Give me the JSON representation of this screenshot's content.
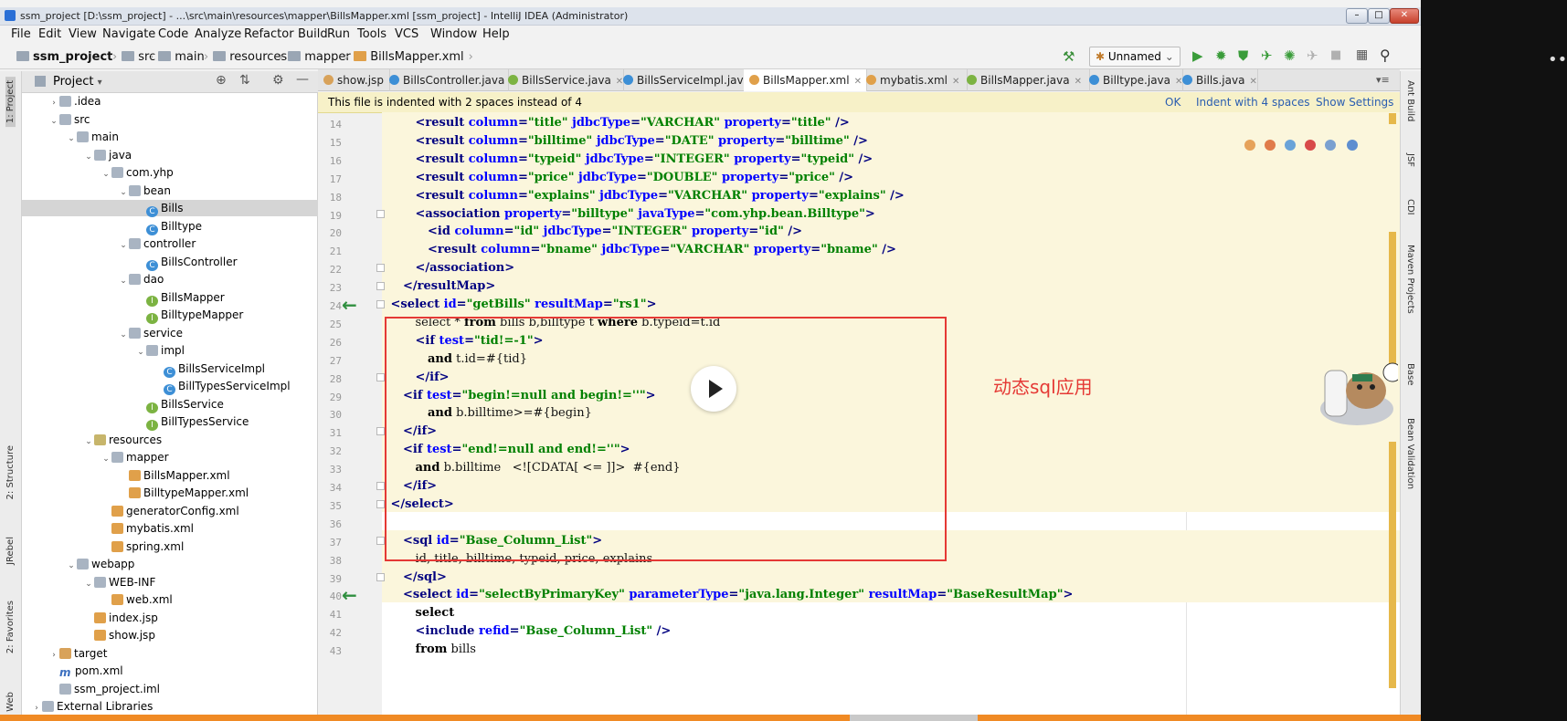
{
  "window": {
    "title": "ssm_project [D:\\ssm_project] - ...\\src\\main\\resources\\mapper\\BillsMapper.xml [ssm_project] - IntelliJ IDEA (Administrator)"
  },
  "menu": [
    "File",
    "Edit",
    "View",
    "Navigate",
    "Code",
    "Analyze",
    "Refactor",
    "Build",
    "Run",
    "Tools",
    "VCS",
    "Window",
    "Help"
  ],
  "breadcrumb": [
    "ssm_project",
    "src",
    "main",
    "resources",
    "mapper",
    "BillsMapper.xml"
  ],
  "run_config": "Unnamed",
  "project_panel": {
    "title": "Project",
    "tree": [
      {
        "label": ".idea",
        "indent": 1,
        "arrow": "›",
        "icon": "folder"
      },
      {
        "label": "src",
        "indent": 1,
        "arrow": "⌄",
        "icon": "folder"
      },
      {
        "label": "main",
        "indent": 2,
        "arrow": "⌄",
        "icon": "folder"
      },
      {
        "label": "java",
        "indent": 3,
        "arrow": "⌄",
        "icon": "folder"
      },
      {
        "label": "com.yhp",
        "indent": 4,
        "arrow": "⌄",
        "icon": "folder"
      },
      {
        "label": "bean",
        "indent": 5,
        "arrow": "⌄",
        "icon": "folder"
      },
      {
        "label": "Bills",
        "indent": 6,
        "arrow": "",
        "icon": "class"
      },
      {
        "label": "Billtype",
        "indent": 6,
        "arrow": "",
        "icon": "class"
      },
      {
        "label": "controller",
        "indent": 5,
        "arrow": "⌄",
        "icon": "folder"
      },
      {
        "label": "BillsController",
        "indent": 6,
        "arrow": "",
        "icon": "class"
      },
      {
        "label": "dao",
        "indent": 5,
        "arrow": "⌄",
        "icon": "folder"
      },
      {
        "label": "BillsMapper",
        "indent": 6,
        "arrow": "",
        "icon": "iface"
      },
      {
        "label": "BilltypeMapper",
        "indent": 6,
        "arrow": "",
        "icon": "iface"
      },
      {
        "label": "service",
        "indent": 5,
        "arrow": "⌄",
        "icon": "folder"
      },
      {
        "label": "impl",
        "indent": 6,
        "arrow": "⌄",
        "icon": "folder"
      },
      {
        "label": "BillsServiceImpl",
        "indent": 7,
        "arrow": "",
        "icon": "class"
      },
      {
        "label": "BillTypesServiceImpl",
        "indent": 7,
        "arrow": "",
        "icon": "class"
      },
      {
        "label": "BillsService",
        "indent": 6,
        "arrow": "",
        "icon": "iface"
      },
      {
        "label": "BillTypesService",
        "indent": 6,
        "arrow": "",
        "icon": "iface"
      },
      {
        "label": "resources",
        "indent": 3,
        "arrow": "⌄",
        "icon": "res"
      },
      {
        "label": "mapper",
        "indent": 4,
        "arrow": "⌄",
        "icon": "folder"
      },
      {
        "label": "BillsMapper.xml",
        "indent": 5,
        "arrow": "",
        "icon": "xml"
      },
      {
        "label": "BilltypeMapper.xml",
        "indent": 5,
        "arrow": "",
        "icon": "xml"
      },
      {
        "label": "generatorConfig.xml",
        "indent": 4,
        "arrow": "",
        "icon": "xml"
      },
      {
        "label": "mybatis.xml",
        "indent": 4,
        "arrow": "",
        "icon": "xml"
      },
      {
        "label": "spring.xml",
        "indent": 4,
        "arrow": "",
        "icon": "xml"
      },
      {
        "label": "webapp",
        "indent": 2,
        "arrow": "⌄",
        "icon": "folder"
      },
      {
        "label": "WEB-INF",
        "indent": 3,
        "arrow": "⌄",
        "icon": "folder"
      },
      {
        "label": "web.xml",
        "indent": 4,
        "arrow": "",
        "icon": "xml"
      },
      {
        "label": "index.jsp",
        "indent": 3,
        "arrow": "",
        "icon": "xml"
      },
      {
        "label": "show.jsp",
        "indent": 3,
        "arrow": "",
        "icon": "xml"
      },
      {
        "label": "target",
        "indent": 1,
        "arrow": "›",
        "icon": "orange"
      },
      {
        "label": "pom.xml",
        "indent": 1,
        "arrow": "",
        "icon": "maven"
      },
      {
        "label": "ssm_project.iml",
        "indent": 1,
        "arrow": "",
        "icon": "folder"
      },
      {
        "label": "External Libraries",
        "indent": 0,
        "arrow": "›",
        "icon": "folder"
      }
    ]
  },
  "tabs": [
    {
      "label": "show.jsp",
      "color": "#d8a25a"
    },
    {
      "label": "BillsController.java",
      "color": "#3d8fd6"
    },
    {
      "label": "BillsService.java",
      "color": "#7cb342"
    },
    {
      "label": "BillsServiceImpl.java",
      "color": "#3d8fd6"
    },
    {
      "label": "BillsMapper.xml",
      "color": "#e0a04a"
    },
    {
      "label": "mybatis.xml",
      "color": "#e0a04a"
    },
    {
      "label": "BillsMapper.java",
      "color": "#7cb342"
    },
    {
      "label": "Billtype.java",
      "color": "#3d8fd6"
    },
    {
      "label": "Bills.java",
      "color": "#3d8fd6"
    }
  ],
  "notification": {
    "message": "This file is indented with 2 spaces instead of 4",
    "ok": "OK",
    "indent": "Indent with 4 spaces",
    "settings": "Show Settings"
  },
  "code": [
    {
      "n": "14",
      "ind": 3,
      "h": [
        [
          "tag",
          "<result "
        ],
        [
          "attr",
          "column"
        ],
        [
          "tag",
          "="
        ],
        [
          "val",
          "\"title\""
        ],
        [
          "tag",
          " "
        ],
        [
          "attr",
          "jdbcType"
        ],
        [
          "tag",
          "="
        ],
        [
          "val",
          "\"VARCHAR\""
        ],
        [
          "tag",
          " "
        ],
        [
          "attr",
          "property"
        ],
        [
          "tag",
          "="
        ],
        [
          "val",
          "\"title\""
        ],
        [
          "tag",
          " />"
        ]
      ]
    },
    {
      "n": "15",
      "ind": 3,
      "h": [
        [
          "tag",
          "<result "
        ],
        [
          "attr",
          "column"
        ],
        [
          "tag",
          "="
        ],
        [
          "val",
          "\"billtime\""
        ],
        [
          "tag",
          " "
        ],
        [
          "attr",
          "jdbcType"
        ],
        [
          "tag",
          "="
        ],
        [
          "val",
          "\"DATE\""
        ],
        [
          "tag",
          " "
        ],
        [
          "attr",
          "property"
        ],
        [
          "tag",
          "="
        ],
        [
          "val",
          "\"billtime\""
        ],
        [
          "tag",
          " />"
        ]
      ]
    },
    {
      "n": "16",
      "ind": 3,
      "h": [
        [
          "tag",
          "<result "
        ],
        [
          "attr",
          "column"
        ],
        [
          "tag",
          "="
        ],
        [
          "val",
          "\"typeid\""
        ],
        [
          "tag",
          " "
        ],
        [
          "attr",
          "jdbcType"
        ],
        [
          "tag",
          "="
        ],
        [
          "val",
          "\"INTEGER\""
        ],
        [
          "tag",
          " "
        ],
        [
          "attr",
          "property"
        ],
        [
          "tag",
          "="
        ],
        [
          "val",
          "\"typeid\""
        ],
        [
          "tag",
          " />"
        ]
      ]
    },
    {
      "n": "17",
      "ind": 3,
      "h": [
        [
          "tag",
          "<result "
        ],
        [
          "attr",
          "column"
        ],
        [
          "tag",
          "="
        ],
        [
          "val",
          "\"price\""
        ],
        [
          "tag",
          " "
        ],
        [
          "attr",
          "jdbcType"
        ],
        [
          "tag",
          "="
        ],
        [
          "val",
          "\"DOUBLE\""
        ],
        [
          "tag",
          " "
        ],
        [
          "attr",
          "property"
        ],
        [
          "tag",
          "="
        ],
        [
          "val",
          "\"price\""
        ],
        [
          "tag",
          " />"
        ]
      ]
    },
    {
      "n": "18",
      "ind": 3,
      "h": [
        [
          "tag",
          "<result "
        ],
        [
          "attr",
          "column"
        ],
        [
          "tag",
          "="
        ],
        [
          "val",
          "\"explains\""
        ],
        [
          "tag",
          " "
        ],
        [
          "attr",
          "jdbcType"
        ],
        [
          "tag",
          "="
        ],
        [
          "val",
          "\"VARCHAR\""
        ],
        [
          "tag",
          " "
        ],
        [
          "attr",
          "property"
        ],
        [
          "tag",
          "="
        ],
        [
          "val",
          "\"explains\""
        ],
        [
          "tag",
          " />"
        ]
      ]
    },
    {
      "n": "19",
      "ind": 3,
      "h": [
        [
          "tag",
          "<association "
        ],
        [
          "attr",
          "property"
        ],
        [
          "tag",
          "="
        ],
        [
          "val",
          "\"billtype\""
        ],
        [
          "tag",
          " "
        ],
        [
          "attr",
          "javaType"
        ],
        [
          "tag",
          "="
        ],
        [
          "val",
          "\"com.yhp.bean.Billtype\""
        ],
        [
          "tag",
          ">"
        ]
      ]
    },
    {
      "n": "20",
      "ind": 4,
      "h": [
        [
          "tag",
          "<id "
        ],
        [
          "attr",
          "column"
        ],
        [
          "tag",
          "="
        ],
        [
          "val",
          "\"id\""
        ],
        [
          "tag",
          " "
        ],
        [
          "attr",
          "jdbcType"
        ],
        [
          "tag",
          "="
        ],
        [
          "val",
          "\"INTEGER\""
        ],
        [
          "tag",
          " "
        ],
        [
          "attr",
          "property"
        ],
        [
          "tag",
          "="
        ],
        [
          "val",
          "\"id\""
        ],
        [
          "tag",
          " />"
        ]
      ]
    },
    {
      "n": "21",
      "ind": 4,
      "h": [
        [
          "tag",
          "<result "
        ],
        [
          "attr",
          "column"
        ],
        [
          "tag",
          "="
        ],
        [
          "val",
          "\"bname\""
        ],
        [
          "tag",
          " "
        ],
        [
          "attr",
          "jdbcType"
        ],
        [
          "tag",
          "="
        ],
        [
          "val",
          "\"VARCHAR\""
        ],
        [
          "tag",
          " "
        ],
        [
          "attr",
          "property"
        ],
        [
          "tag",
          "="
        ],
        [
          "val",
          "\"bname\""
        ],
        [
          "tag",
          " />"
        ]
      ]
    },
    {
      "n": "22",
      "ind": 3,
      "h": [
        [
          "tag",
          "</association>"
        ]
      ]
    },
    {
      "n": "23",
      "ind": 2,
      "h": [
        [
          "tag",
          "</resultMap>"
        ]
      ]
    },
    {
      "n": "24",
      "ind": 1,
      "h": [
        [
          "tag",
          "<select "
        ],
        [
          "attr",
          "id"
        ],
        [
          "tag",
          "="
        ],
        [
          "val",
          "\"getBills\""
        ],
        [
          "tag",
          " "
        ],
        [
          "attr",
          "resultMap"
        ],
        [
          "tag",
          "="
        ],
        [
          "val",
          "\"rs1\""
        ],
        [
          "tag",
          ">"
        ]
      ]
    },
    {
      "n": "25",
      "ind": 3,
      "h": [
        [
          "plain",
          "select * "
        ],
        [
          "kw",
          "from"
        ],
        [
          "plain",
          " bills b,billtype t "
        ],
        [
          "kw",
          "where"
        ],
        [
          "plain",
          " b.typeid=t.id"
        ]
      ]
    },
    {
      "n": "26",
      "ind": 3,
      "h": [
        [
          "tag",
          "<if "
        ],
        [
          "attr",
          "test"
        ],
        [
          "tag",
          "="
        ],
        [
          "val",
          "\"tid!=-1\""
        ],
        [
          "tag",
          ">"
        ]
      ]
    },
    {
      "n": "27",
      "ind": 4,
      "h": [
        [
          "kw",
          "and"
        ],
        [
          "plain",
          " t.id=#{tid}"
        ]
      ]
    },
    {
      "n": "28",
      "ind": 3,
      "h": [
        [
          "tag",
          "</if>"
        ]
      ]
    },
    {
      "n": "29",
      "ind": 2,
      "h": [
        [
          "tag",
          "<if "
        ],
        [
          "attr",
          "test"
        ],
        [
          "tag",
          "="
        ],
        [
          "val",
          "\"begin!=null and begin!=''\""
        ],
        [
          "tag",
          ">"
        ]
      ]
    },
    {
      "n": "30",
      "ind": 4,
      "h": [
        [
          "kw",
          "and"
        ],
        [
          "plain",
          " b.billtime>=#{begin}"
        ]
      ]
    },
    {
      "n": "31",
      "ind": 2,
      "h": [
        [
          "tag",
          "</if>"
        ]
      ]
    },
    {
      "n": "32",
      "ind": 2,
      "h": [
        [
          "tag",
          "<if "
        ],
        [
          "attr",
          "test"
        ],
        [
          "tag",
          "="
        ],
        [
          "val",
          "\"end!=null and end!=''\""
        ],
        [
          "tag",
          ">"
        ]
      ]
    },
    {
      "n": "33",
      "ind": 3,
      "h": [
        [
          "kw",
          "and"
        ],
        [
          "plain",
          " b.billtime   <![CDATA[ <= ]]>  #{end}"
        ]
      ]
    },
    {
      "n": "34",
      "ind": 2,
      "h": [
        [
          "tag",
          "</if>"
        ]
      ]
    },
    {
      "n": "35",
      "ind": 1,
      "h": [
        [
          "tag",
          "</select>"
        ]
      ]
    },
    {
      "n": "36",
      "ind": 0,
      "h": []
    },
    {
      "n": "37",
      "ind": 2,
      "h": [
        [
          "tag",
          "<sql "
        ],
        [
          "attr",
          "id"
        ],
        [
          "tag",
          "="
        ],
        [
          "val",
          "\"Base_Column_List\""
        ],
        [
          "tag",
          ">"
        ]
      ]
    },
    {
      "n": "38",
      "ind": 3,
      "h": [
        [
          "plain",
          "id, title, billtime, typeid, price, explains"
        ]
      ]
    },
    {
      "n": "39",
      "ind": 2,
      "h": [
        [
          "tag",
          "</sql>"
        ]
      ]
    },
    {
      "n": "40",
      "ind": 2,
      "h": [
        [
          "tag",
          "<select "
        ],
        [
          "attr",
          "id"
        ],
        [
          "tag",
          "="
        ],
        [
          "val",
          "\"selectByPrimaryKey\""
        ],
        [
          "tag",
          " "
        ],
        [
          "attr",
          "parameterType"
        ],
        [
          "tag",
          "="
        ],
        [
          "val",
          "\"java.lang.Integer\""
        ],
        [
          "tag",
          " "
        ],
        [
          "attr",
          "resultMap"
        ],
        [
          "tag",
          "="
        ],
        [
          "val",
          "\"BaseResultMap\""
        ],
        [
          "tag",
          ">"
        ]
      ]
    },
    {
      "n": "41",
      "ind": 3,
      "h": [
        [
          "kw",
          "select"
        ]
      ]
    },
    {
      "n": "42",
      "ind": 3,
      "h": [
        [
          "tag",
          "<include "
        ],
        [
          "attr",
          "refid"
        ],
        [
          "tag",
          "="
        ],
        [
          "val",
          "\"Base_Column_List\""
        ],
        [
          "tag",
          " />"
        ]
      ]
    },
    {
      "n": "43",
      "ind": 3,
      "h": [
        [
          "kw",
          "from"
        ],
        [
          "plain",
          " bills"
        ]
      ]
    }
  ],
  "annotation": "动态sql应用",
  "left_tool_windows": [
    "1: Project",
    "2: Structure",
    "JRebel",
    "2: Favorites",
    "Web"
  ],
  "right_tool_windows": [
    "Ant Build",
    "JSF",
    "CDI",
    "Maven Projects",
    "Base",
    "Bean Validation"
  ]
}
